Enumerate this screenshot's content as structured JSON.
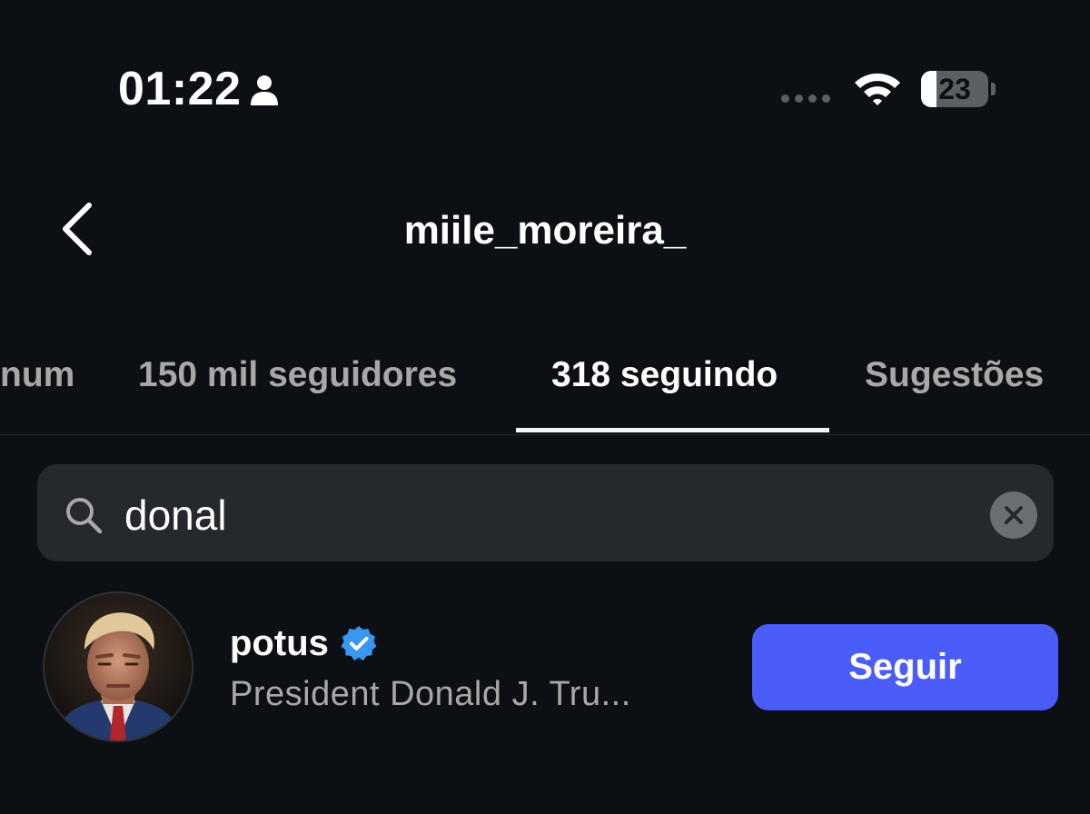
{
  "status_bar": {
    "time": "01:22",
    "battery_level": "23",
    "battery_fraction": 0.23,
    "icons": [
      "person-icon",
      "signal-icon",
      "wifi-icon",
      "battery-icon"
    ]
  },
  "header": {
    "title": "miile_moreira_",
    "back_icon": "chevron-left-icon"
  },
  "tabs": [
    {
      "label": "num",
      "active": false
    },
    {
      "label": "150 mil seguidores",
      "active": false
    },
    {
      "label": "318 seguindo",
      "active": true
    },
    {
      "label": "Sugestões",
      "active": false
    }
  ],
  "search": {
    "value": "donal",
    "icon": "search-icon",
    "clear_icon": "close-icon"
  },
  "results": [
    {
      "username": "potus",
      "verified": true,
      "full_name": "President Donald J. Tru...",
      "action_label": "Seguir"
    }
  ],
  "colors": {
    "background": "#0c1014",
    "search_bg": "#25292e",
    "follow_button": "#4a5df9",
    "verified_badge": "#3897f0",
    "secondary_text": "#a8a8a8"
  }
}
